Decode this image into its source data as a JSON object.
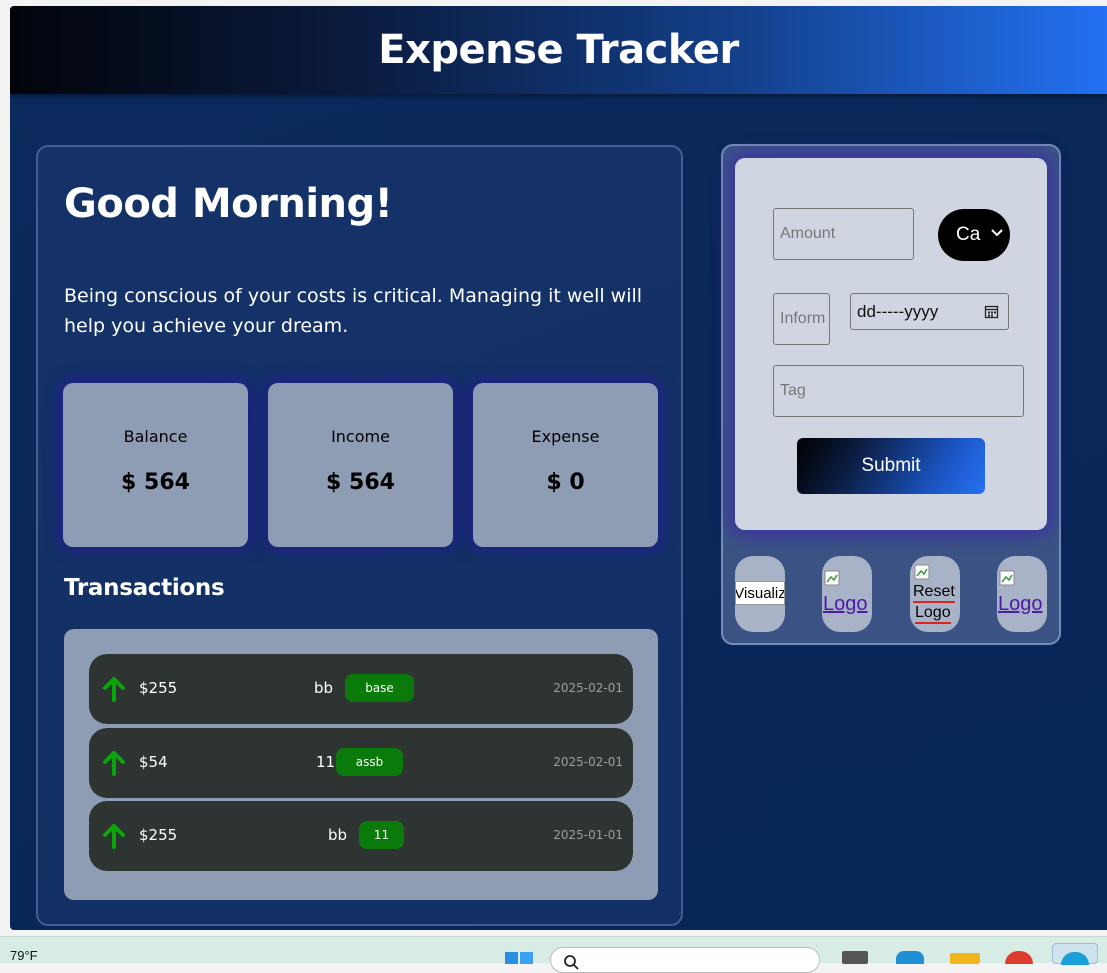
{
  "header": {
    "title": "Expense Tracker"
  },
  "greeting": "Good Morning!",
  "tagline": "Being conscious of your costs is critical. Managing it well will help you achieve your dream.",
  "stats": {
    "balance": {
      "label": "Balance",
      "value": "$ 564"
    },
    "income": {
      "label": "Income",
      "value": "$ 564"
    },
    "expense": {
      "label": "Expense",
      "value": "$ 0"
    }
  },
  "transactions_title": "Transactions",
  "transactions": [
    {
      "amount": "$255",
      "info": "bb",
      "tag": "base",
      "date": "2025-02-01"
    },
    {
      "amount": "$54",
      "info": "11",
      "tag": "assb",
      "date": "2025-02-01"
    },
    {
      "amount": "$255",
      "info": "bb",
      "tag": "11",
      "date": "2025-01-01"
    }
  ],
  "form": {
    "amount_placeholder": "Amount",
    "category_value": "Ca",
    "information_placeholder": "Inform",
    "date_placeholder": "dd-----yyyy",
    "tag_placeholder": "Tag",
    "submit_label": "Submit"
  },
  "icon_buttons": {
    "visualize_alt": "Visualiz",
    "logo_alt": "Logo",
    "reset_alt_line1": "Reset",
    "reset_alt_line2": "Logo",
    "logo2_alt": "Logo"
  },
  "taskbar": {
    "weather": "79°F"
  },
  "colors": {
    "income_arrow": "#0aa50a",
    "tag_bg": "#0a7a0a",
    "card_bg": "#8f9db4"
  }
}
